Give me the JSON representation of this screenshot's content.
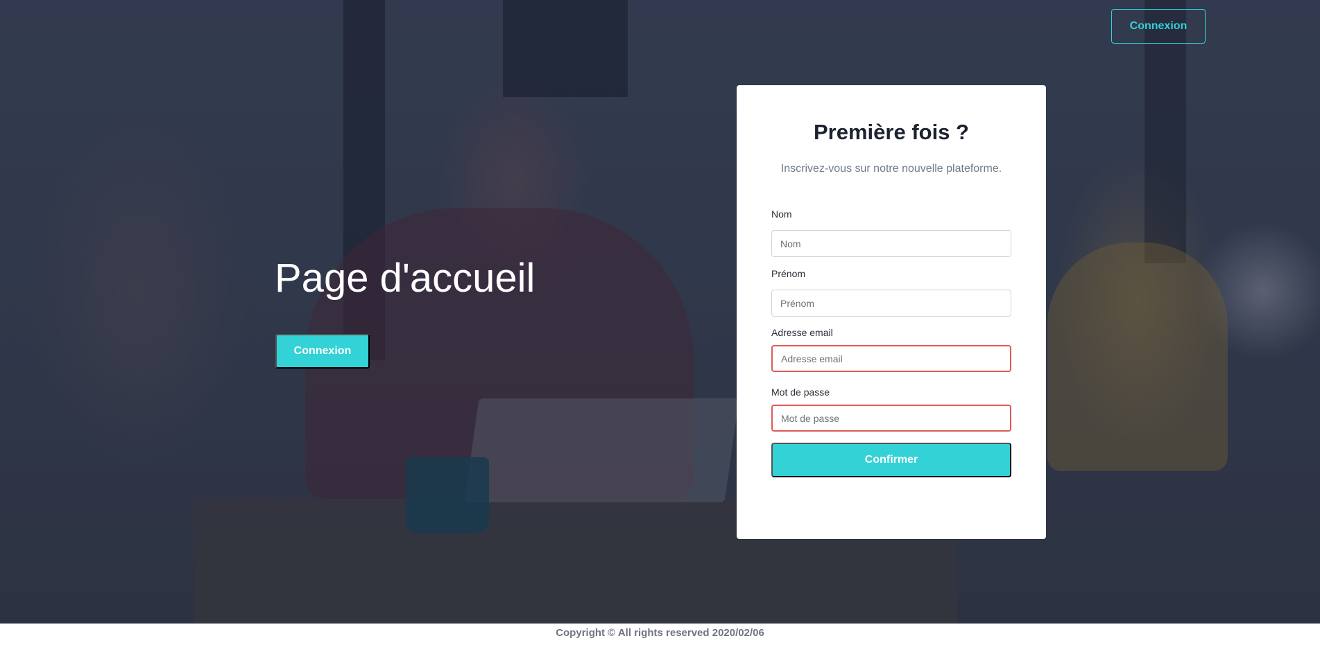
{
  "header": {
    "login_label": "Connexion"
  },
  "hero": {
    "title": "Page d'accueil",
    "login_label": "Connexion"
  },
  "signup_card": {
    "title": "Première fois ?",
    "subtitle": "Inscrivez-vous sur notre nouvelle plateforme.",
    "fields": [
      {
        "label": "Nom",
        "placeholder": "Nom",
        "value": "",
        "invalid": false
      },
      {
        "label": "Prénom",
        "placeholder": "Prénom",
        "value": "",
        "invalid": false
      },
      {
        "label": "Adresse email",
        "placeholder": "Adresse email",
        "value": "",
        "invalid": true
      },
      {
        "label": "Mot de passe",
        "placeholder": "Mot de passe",
        "value": "",
        "invalid": true
      }
    ],
    "submit_label": "Confirmer"
  },
  "footer": {
    "copyright": "Copyright © All rights reserved 2020/02/06"
  },
  "colors": {
    "accent": "#32d2d6",
    "invalid_border": "#e05a5a",
    "card_background": "#ffffff"
  }
}
